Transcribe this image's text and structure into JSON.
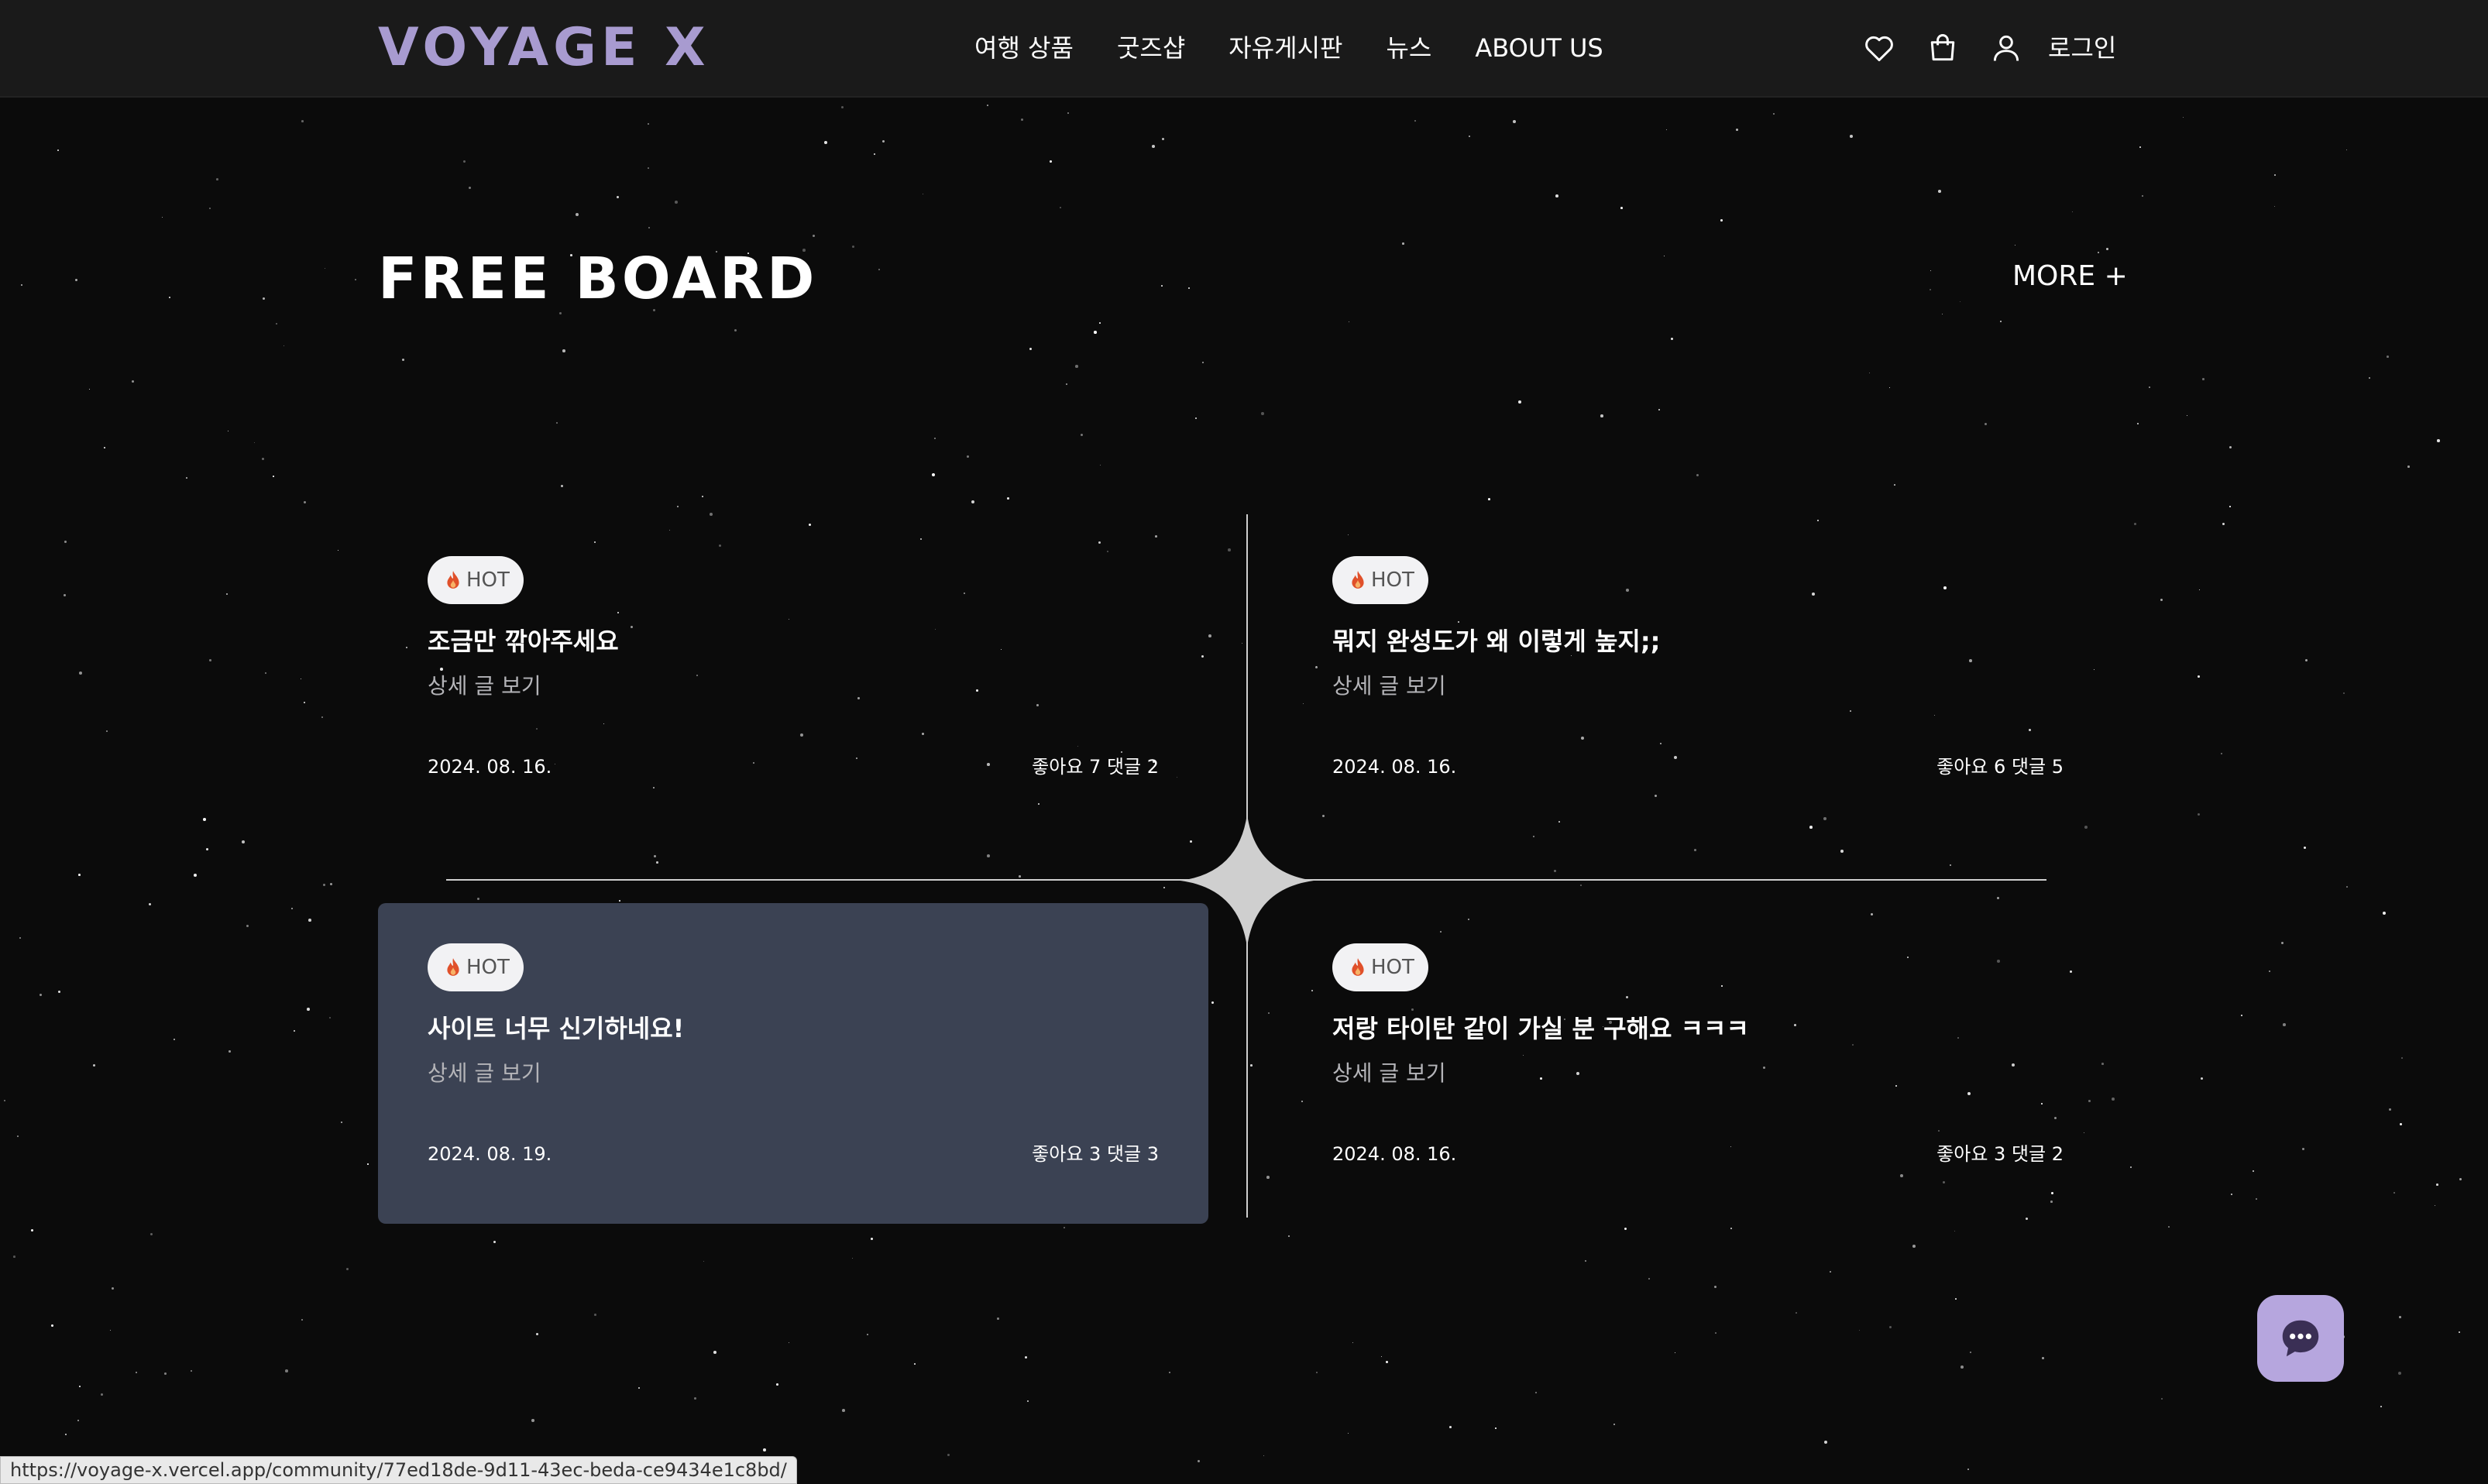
{
  "header": {
    "logo": "VOYAGE X",
    "nav": [
      "여행 상품",
      "굿즈샵",
      "자유게시판",
      "뉴스",
      "ABOUT US"
    ],
    "icons": [
      "heart-icon",
      "shopping-bag-icon",
      "user-icon"
    ],
    "login_label": "로그인"
  },
  "section": {
    "title": "FREE BOARD",
    "more_label": "MORE +"
  },
  "posts": [
    {
      "badge": "HOT",
      "title": "조금만 깎아주세요",
      "sub": "상세 글 보기",
      "date": "2024. 08. 16.",
      "stats": "좋아요 7 댓글 2"
    },
    {
      "badge": "HOT",
      "title": "뭐지 완성도가 왜 이렇게 높지;;",
      "sub": "상세 글 보기",
      "date": "2024. 08. 16.",
      "stats": "좋아요 6 댓글 5"
    },
    {
      "badge": "HOT",
      "title": "사이트 너무 신기하네요!",
      "sub": "상세 글 보기",
      "date": "2024. 08. 19.",
      "stats": "좋아요 3 댓글 3"
    },
    {
      "badge": "HOT",
      "title": "저랑 타이탄 같이 가실 분 구해요 ㅋㅋㅋ",
      "sub": "상세 글 보기",
      "date": "2024. 08. 16.",
      "stats": "좋아요 3 댓글 2"
    }
  ],
  "status_url": "https://voyage-x.vercel.app/community/77ed18de-9d11-43ec-beda-ce9434e1c8bd/",
  "colors": {
    "background": "#0b0b0b",
    "header_bg": "#1a1a1a",
    "logo": "#a89bd0",
    "card_highlight": "#3b4253",
    "chat_button": "#b6a6de",
    "hot_icon": "#e0502a"
  }
}
